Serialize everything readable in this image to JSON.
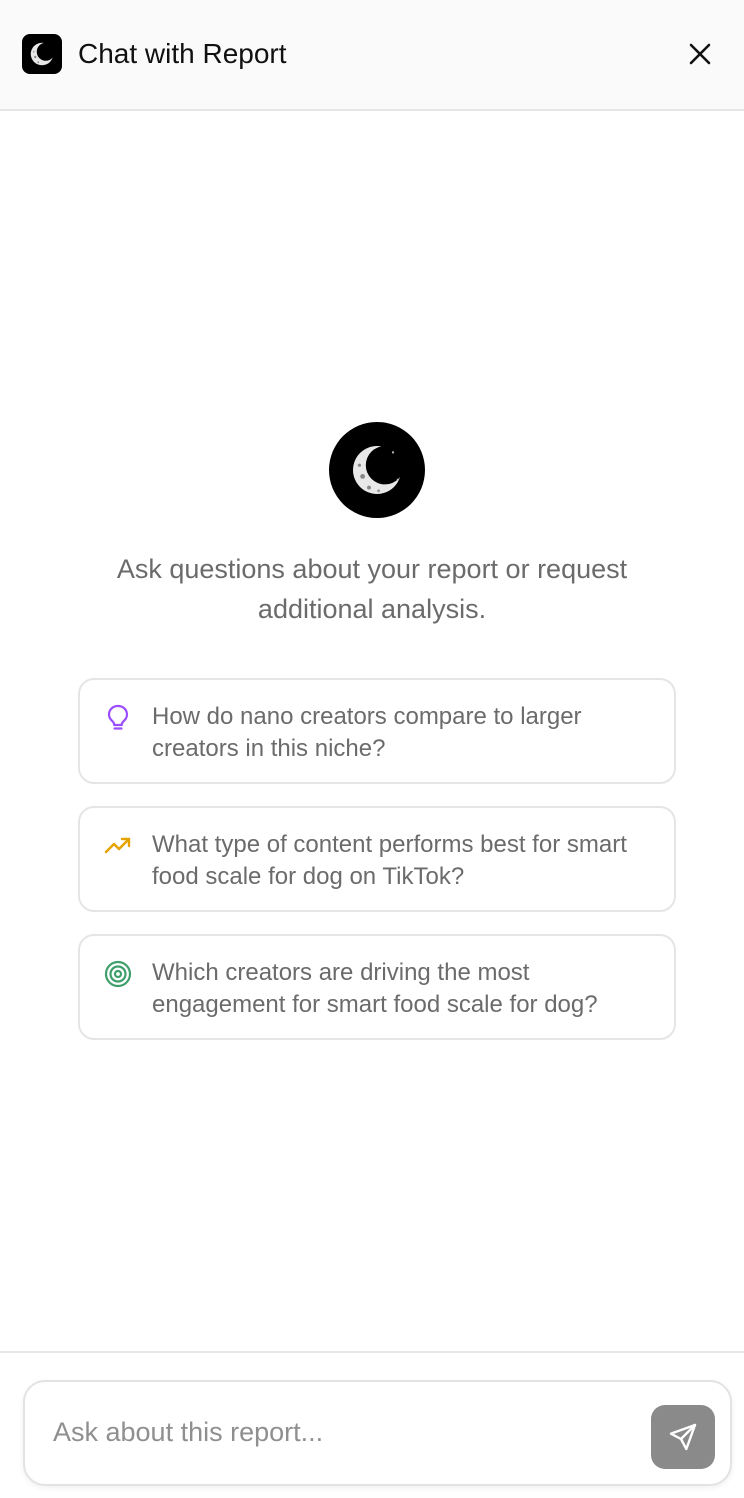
{
  "header": {
    "title": "Chat with Report",
    "logo_icon": "crescent-moon-logo",
    "close_icon": "close-icon"
  },
  "empty_state": {
    "logo_icon": "crescent-moon-logo",
    "intro_text": "Ask questions about your report or request additional analysis."
  },
  "suggestions": [
    {
      "icon": "lightbulb-icon",
      "icon_color": "#9b4dff",
      "text": "How do nano creators compare to larger creators in this niche?"
    },
    {
      "icon": "trending-up-icon",
      "icon_color": "#e5a200",
      "text": "What type of content performs best for smart food scale for dog on TikTok?"
    },
    {
      "icon": "target-icon",
      "icon_color": "#3f9f6a",
      "text": "Which creators are driving the most engagement for smart food scale for dog?"
    }
  ],
  "composer": {
    "placeholder": "Ask about this report...",
    "value": "",
    "send_icon": "send-icon"
  }
}
